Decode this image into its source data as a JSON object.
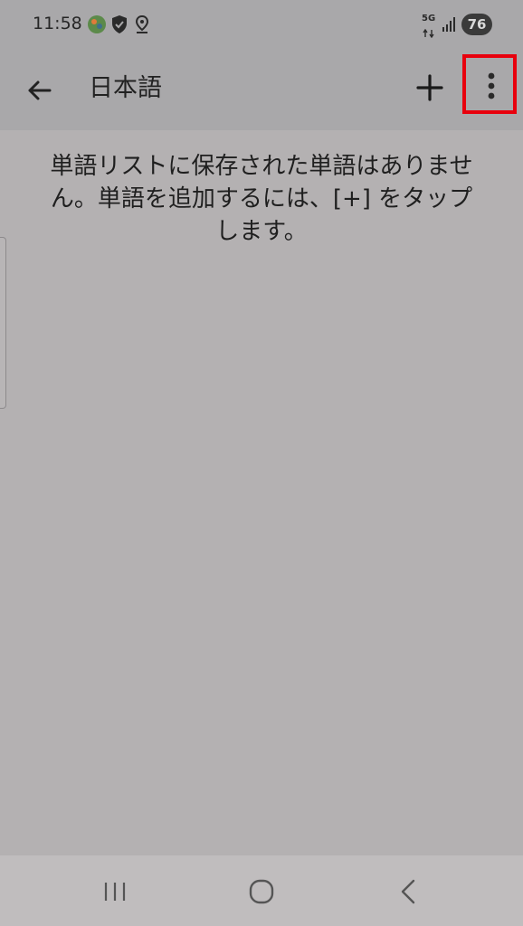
{
  "status_bar": {
    "time": "11:58",
    "network": "5G",
    "battery": "76",
    "icons": [
      "app-notification-icon",
      "shield-icon",
      "location-icon",
      "signal-icon"
    ]
  },
  "app_bar": {
    "title": "日本語",
    "back_icon": "arrow-left-icon",
    "add_icon": "plus-icon",
    "more_icon": "more-vert-icon",
    "highlight_color": "#e8000d"
  },
  "content": {
    "empty_message_line1": "単語リストに保存された単語はありませ",
    "empty_message_line2": "ん。単語を追加するには、[+] をタップ",
    "empty_message_line3": "します。"
  },
  "nav_bar": {
    "icons": [
      "recents-icon",
      "home-icon",
      "back-icon"
    ]
  }
}
